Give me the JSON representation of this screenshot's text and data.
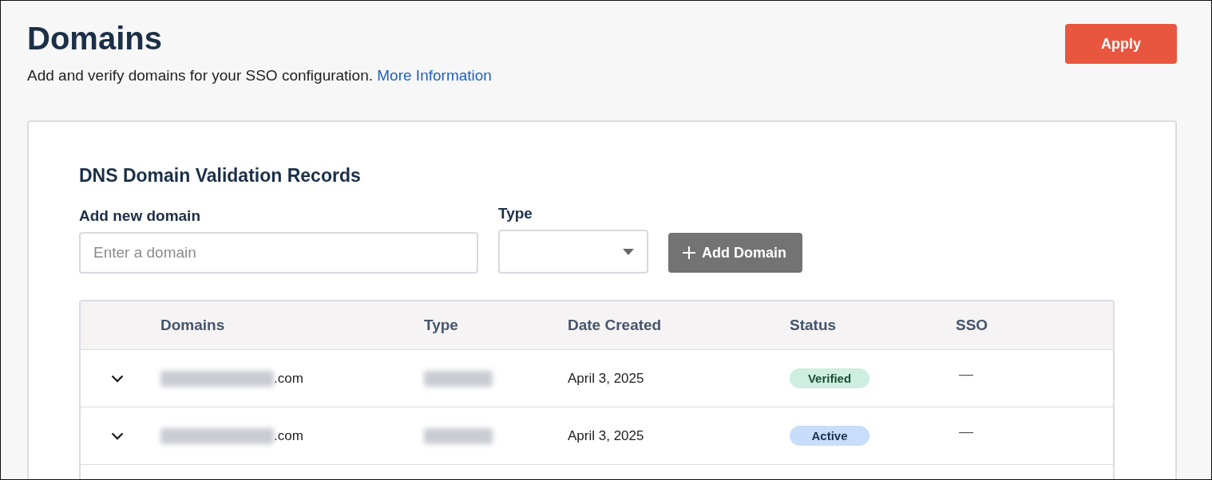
{
  "page": {
    "title": "Domains",
    "description": "Add and verify domains for your SSO configuration.",
    "info_link": "More Information",
    "apply_button": "Apply"
  },
  "card": {
    "title": "DNS Domain Validation Records",
    "domain_field": {
      "label": "Add new domain",
      "placeholder": "Enter a domain"
    },
    "type_field": {
      "label": "Type"
    },
    "add_button": "Add Domain",
    "table": {
      "columns": [
        "Domains",
        "Type",
        "Date Created",
        "Status",
        "SSO"
      ],
      "rows": [
        {
          "expanded": false,
          "domain": ".com",
          "date_created": "April 3, 2025",
          "status": {
            "label": "Verified",
            "kind": "verified"
          },
          "sso": "—"
        },
        {
          "expanded": false,
          "domain": ".com",
          "date_created": "April 3, 2025",
          "status": {
            "label": "Active",
            "kind": "active"
          },
          "sso": "—"
        }
      ]
    }
  }
}
